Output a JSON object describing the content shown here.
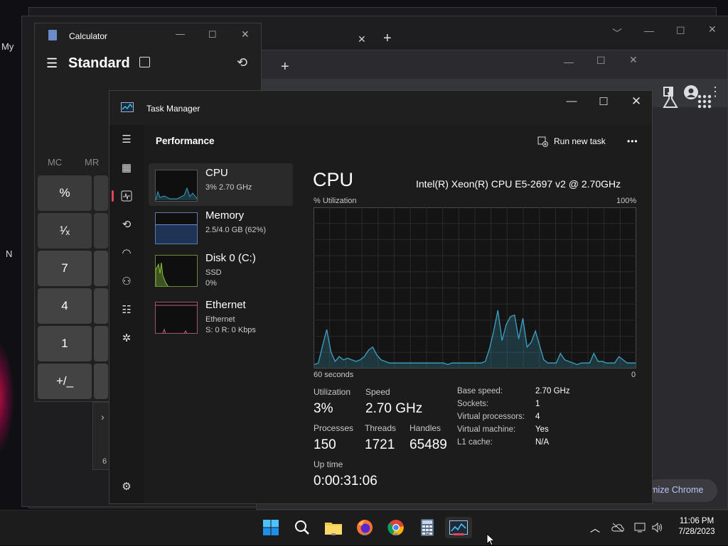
{
  "desktop": {
    "label_my": "My",
    "label_n": "N",
    "chrome_customize": "mize Chrome"
  },
  "calculator": {
    "title": "Calculator",
    "mode": "Standard",
    "memory": [
      "MC",
      "MR"
    ],
    "keys": [
      "%",
      "¹⁄ₓ",
      "7",
      "4",
      "1",
      "+/_"
    ],
    "partial_6": "6"
  },
  "task_manager": {
    "title": "Task Manager",
    "section": "Performance",
    "run_new_task": "Run new task",
    "more": "•••",
    "items": [
      {
        "title": "CPU",
        "sub1": "3% 2.70 GHz",
        "sub2": ""
      },
      {
        "title": "Memory",
        "sub1": "2.5/4.0 GB (62%)",
        "sub2": ""
      },
      {
        "title": "Disk 0 (C:)",
        "sub1": "SSD",
        "sub2": "0%"
      },
      {
        "title": "Ethernet",
        "sub1": "Ethernet",
        "sub2": "S: 0 R: 0 Kbps"
      }
    ],
    "cpu": {
      "heading": "CPU",
      "model": "Intel(R) Xeon(R) CPU E5-2697 v2 @ 2.70GHz",
      "util_label": "% Utilization",
      "max_label": "100%",
      "time_label": "60 seconds",
      "min_label": "0",
      "utilization_label": "Utilization",
      "utilization": "3%",
      "speed_label": "Speed",
      "speed": "2.70 GHz",
      "processes_label": "Processes",
      "processes": "150",
      "threads_label": "Threads",
      "threads": "1721",
      "handles_label": "Handles",
      "handles": "65489",
      "uptime_label": "Up time",
      "uptime": "0:00:31:06",
      "details": [
        {
          "k": "Base speed:",
          "v": "2.70 GHz"
        },
        {
          "k": "Sockets:",
          "v": "1"
        },
        {
          "k": "Virtual processors:",
          "v": "4"
        },
        {
          "k": "Virtual machine:",
          "v": "Yes"
        },
        {
          "k": "L1 cache:",
          "v": "N/A"
        }
      ]
    },
    "graph_series": [
      2,
      3,
      14,
      24,
      10,
      4,
      7,
      5,
      6,
      5,
      4,
      5,
      7,
      11,
      13,
      8,
      5,
      4,
      3,
      3,
      3,
      3,
      3,
      3,
      3,
      3,
      3,
      3,
      3,
      3,
      3,
      3,
      2,
      3,
      3,
      3,
      3,
      3,
      3,
      3,
      3,
      4,
      12,
      23,
      36,
      17,
      27,
      32,
      33,
      18,
      31,
      13,
      16,
      23,
      14,
      5,
      3,
      3,
      3,
      9,
      5,
      4,
      3,
      2,
      3,
      3,
      3,
      9,
      4,
      4,
      3,
      3,
      3,
      7,
      5,
      3,
      3,
      3
    ],
    "graph_color": "#3b9bbd"
  },
  "taskbar": {
    "time": "11:06 PM",
    "date": "7/28/2023"
  }
}
